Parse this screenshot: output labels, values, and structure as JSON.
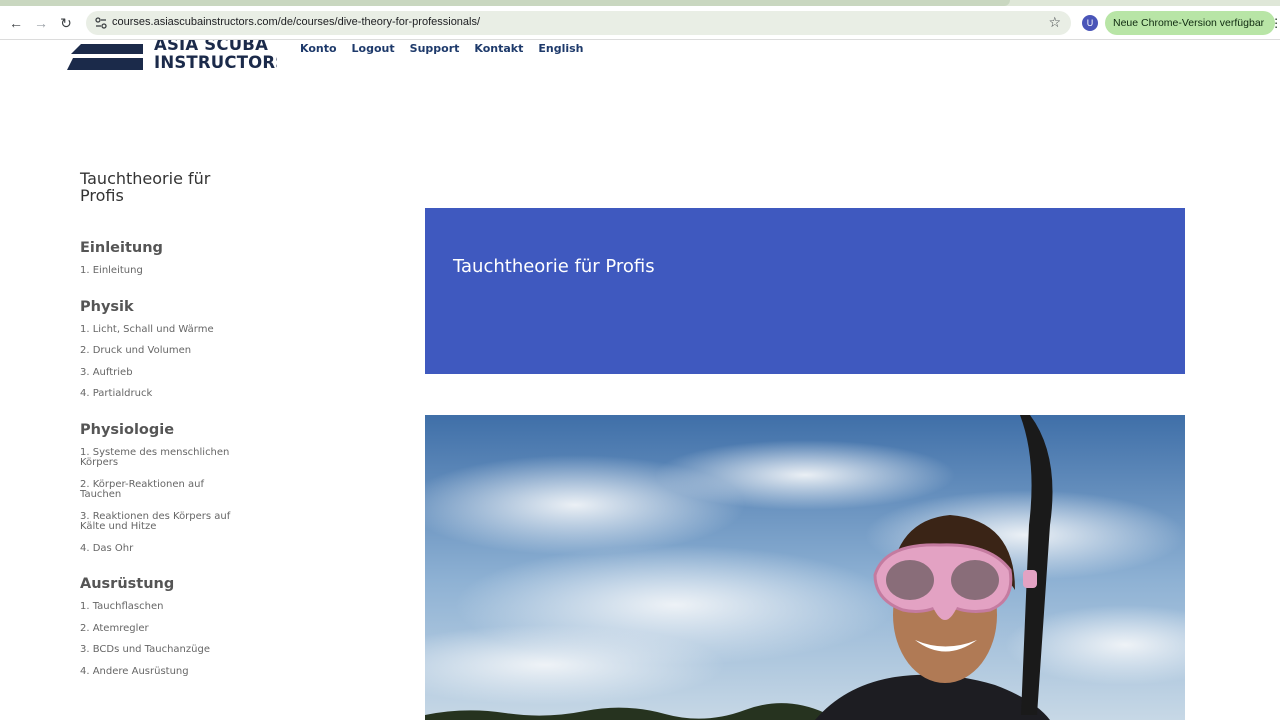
{
  "browser": {
    "url": "courses.asiascubainstructors.com/de/courses/dive-theory-for-professionals/",
    "avatar_initial": "U",
    "update_label": "Neue Chrome-Version verfügbar",
    "icons": [
      "back-icon",
      "forward-icon",
      "reload-icon",
      "site-settings-icon",
      "bookmark-star-icon",
      "more-icon"
    ]
  },
  "site": {
    "logo_line1": "ASIA SCUBA",
    "logo_line2": "INSTRUCTORS",
    "nav": [
      "Konto",
      "Logout",
      "Support",
      "Kontakt",
      "English"
    ]
  },
  "sidebar": {
    "course_title": "Tauchtheorie für Profis",
    "sections": [
      {
        "title": "Einleitung",
        "lessons": [
          "1. Einleitung"
        ]
      },
      {
        "title": "Physik",
        "lessons": [
          "1. Licht, Schall und Wärme",
          "2. Druck und Volumen",
          "3. Auftrieb",
          "4. Partialdruck"
        ]
      },
      {
        "title": "Physiologie",
        "lessons": [
          "1. Systeme des menschlichen Körpers",
          "2. Körper-Reaktionen auf Tauchen",
          "3. Reaktionen des Körpers auf Kälte und Hitze",
          "4. Das Ohr"
        ]
      },
      {
        "title": "Ausrüstung",
        "lessons": [
          "1. Tauchflaschen",
          "2. Atemregler",
          "3. BCDs und Tauchanzüge",
          "4. Andere Ausrüstung"
        ]
      }
    ]
  },
  "main": {
    "banner_title": "Tauchtheorie für Profis"
  },
  "colors": {
    "banner": "#3f59bf",
    "nav_text": "#1e3a6b",
    "update_pill": "#b8e5a6"
  }
}
